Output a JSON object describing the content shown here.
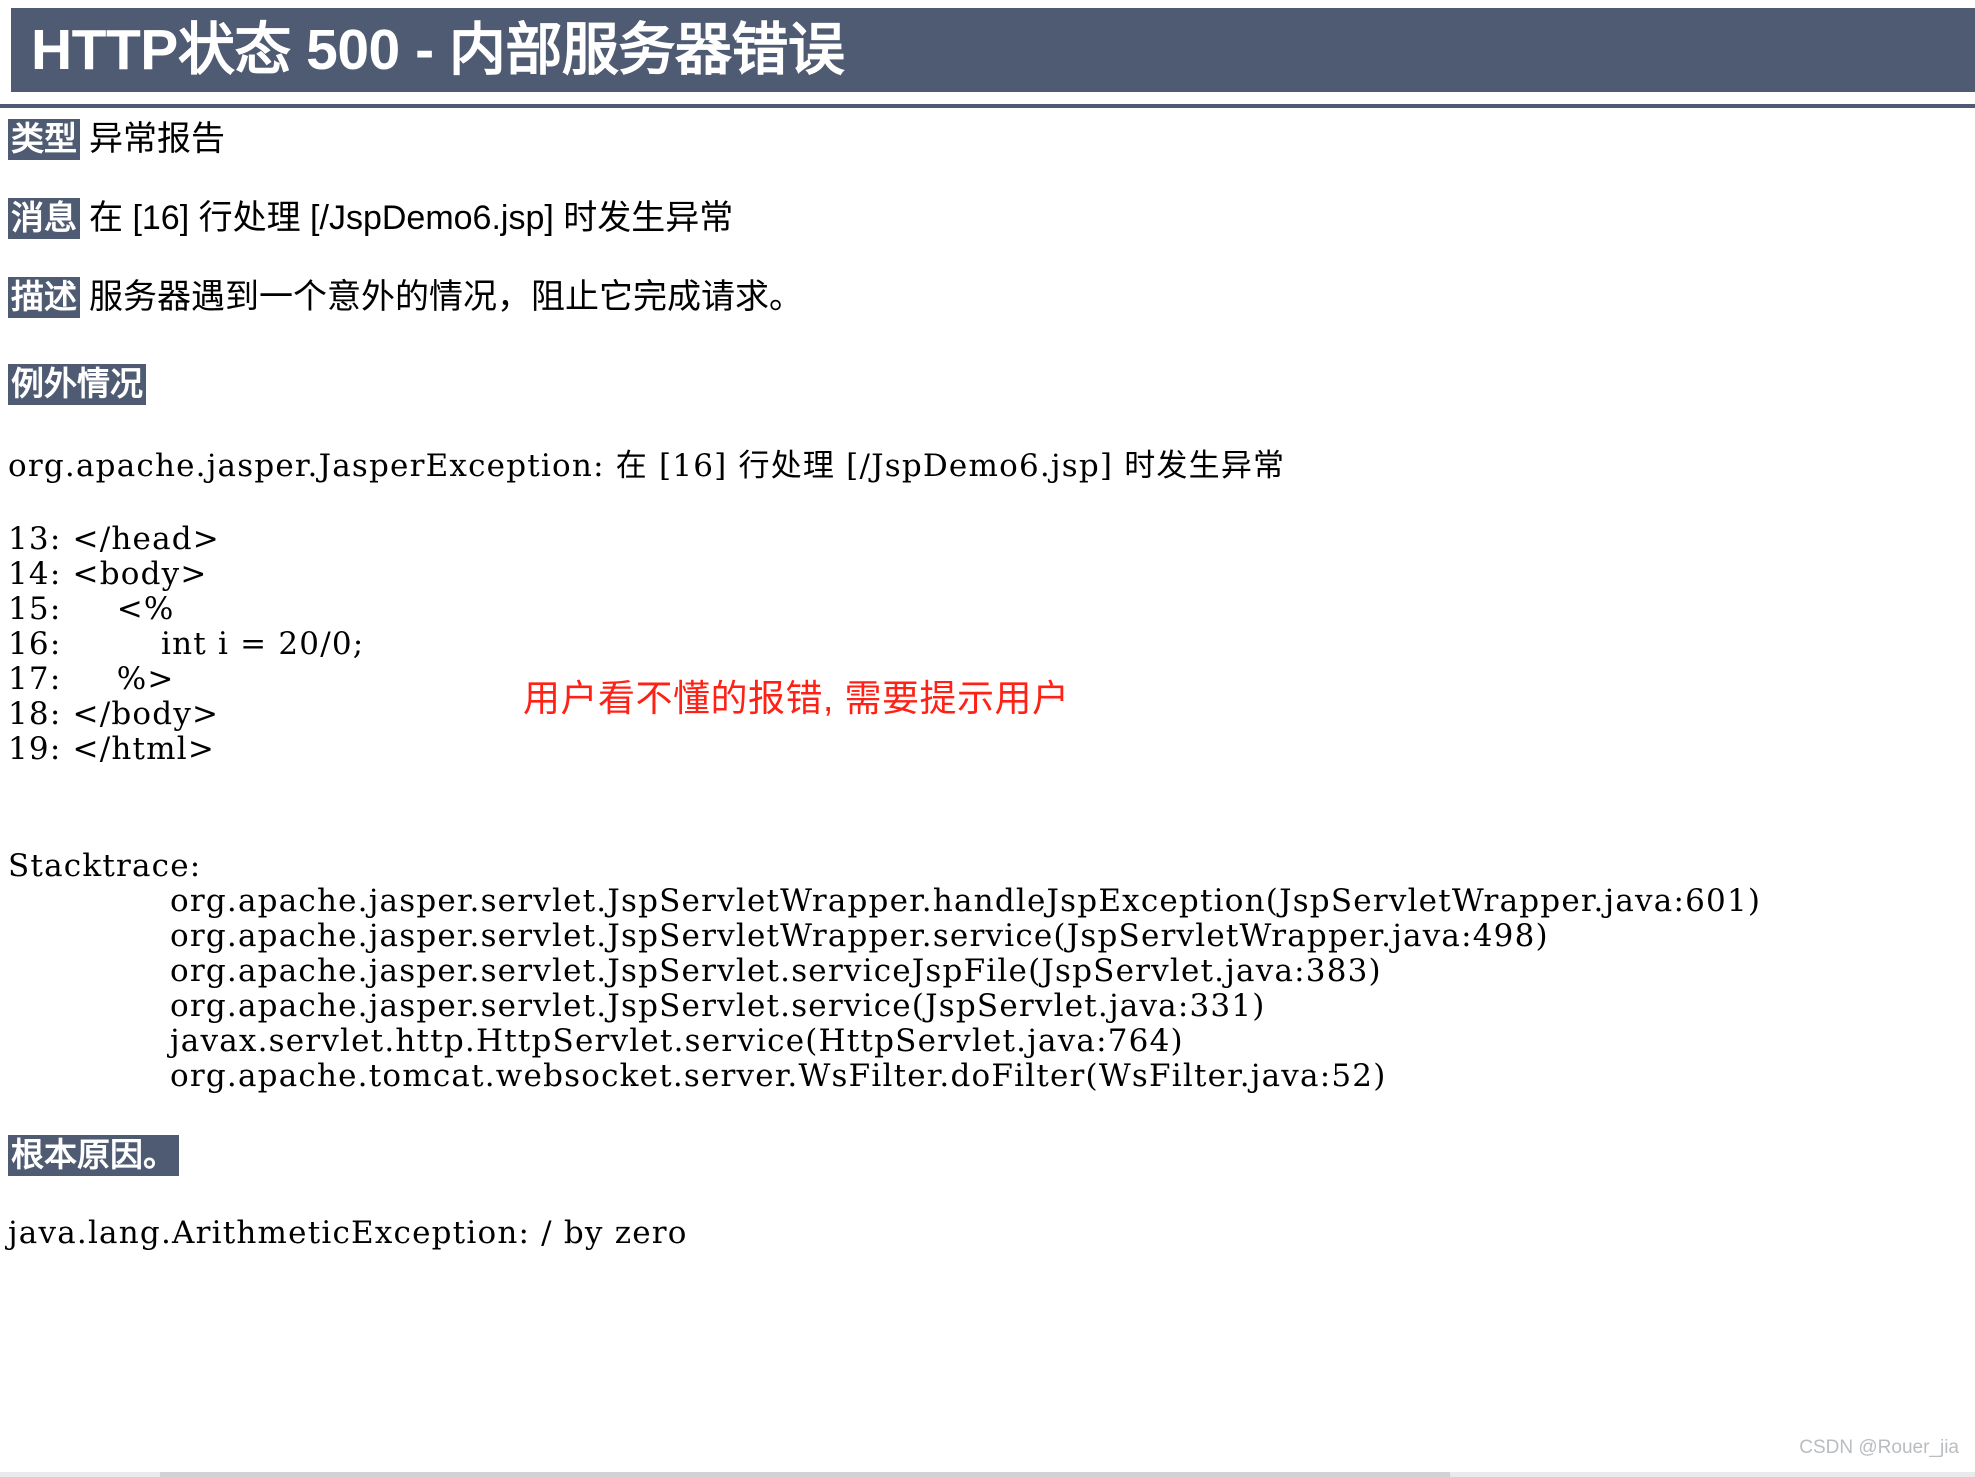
{
  "banner": {
    "title": "HTTP状态 500 - 内部服务器错误",
    "background_color": "#4e5b72",
    "text_color": "#ffffff"
  },
  "fields": [
    {
      "label": "类型",
      "value": "异常报告"
    },
    {
      "label": "消息",
      "value": "在 [16] 行处理 [/JspDemo6.jsp] 时发生异常"
    },
    {
      "label": "描述",
      "value": "服务器遇到一个意外的情况，阻止它完成请求。"
    }
  ],
  "exception_section": {
    "heading": "例外情况",
    "message": "org.apache.jasper.JasperException: 在 [16] 行处理 [/JspDemo6.jsp] 时发生异常",
    "code_listing": [
      "13: </head>",
      "14: <body>",
      "15:     <%",
      "16:         int i = 20/0;",
      "17:     %>",
      "18: </body>",
      "19: </html>"
    ],
    "stacktrace_label": "Stacktrace:",
    "stacktrace": [
      "org.apache.jasper.servlet.JspServletWrapper.handleJspException(JspServletWrapper.java:601)",
      "org.apache.jasper.servlet.JspServletWrapper.service(JspServletWrapper.java:498)",
      "org.apache.jasper.servlet.JspServlet.serviceJspFile(JspServlet.java:383)",
      "org.apache.jasper.servlet.JspServlet.service(JspServlet.java:331)",
      "javax.servlet.http.HttpServlet.service(HttpServlet.java:764)",
      "org.apache.tomcat.websocket.server.WsFilter.doFilter(WsFilter.java:52)"
    ]
  },
  "root_cause_section": {
    "heading": "根本原因。",
    "message": "java.lang.ArithmeticException: / by zero"
  },
  "annotation": {
    "text": "用户看不懂的报错, 需要提示用户",
    "color": "#ff2116"
  },
  "watermark": {
    "text": "CSDN @Rouer_jia"
  }
}
